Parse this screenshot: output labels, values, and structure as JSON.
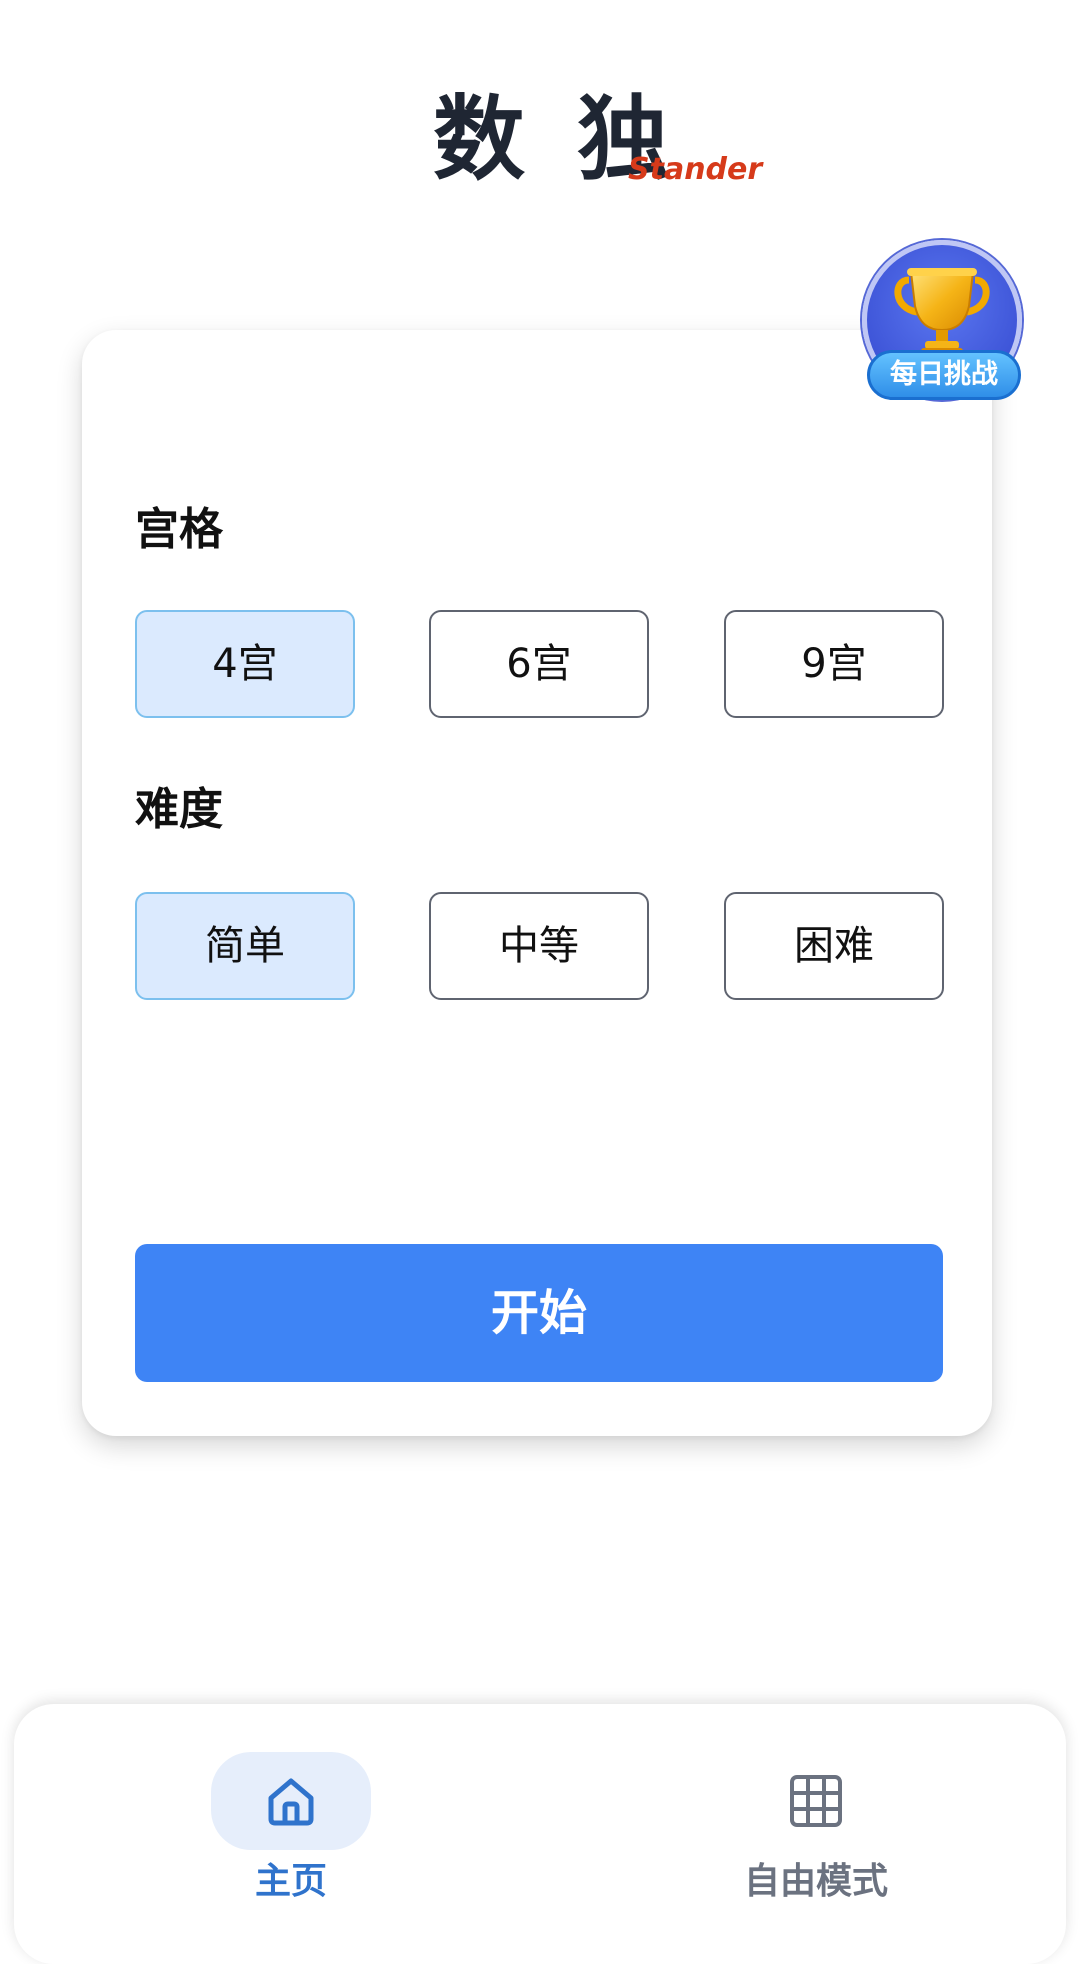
{
  "title": {
    "main": "数 独",
    "sub": "Stander"
  },
  "daily_challenge": {
    "label": "每日挑战",
    "icon": "trophy-icon"
  },
  "grid_section": {
    "label": "宫格",
    "options": [
      {
        "label": "4宫",
        "selected": true
      },
      {
        "label": "6宫",
        "selected": false
      },
      {
        "label": "9宫",
        "selected": false
      }
    ]
  },
  "difficulty_section": {
    "label": "难度",
    "options": [
      {
        "label": "简单",
        "selected": true
      },
      {
        "label": "中等",
        "selected": false
      },
      {
        "label": "困难",
        "selected": false
      }
    ]
  },
  "start_button": {
    "label": "开始"
  },
  "bottom_nav": {
    "items": [
      {
        "label": "主页",
        "icon": "home-icon",
        "active": true
      },
      {
        "label": "自由模式",
        "icon": "grid-icon",
        "active": false
      }
    ]
  },
  "colors": {
    "primary": "#3e84f5",
    "selected_bg": "#dbeafe",
    "selected_border": "#7cc0ee",
    "title": "#1f2633",
    "subtitle_accent": "#d63a1a",
    "nav_active": "#2f73cc",
    "nav_inactive": "#6b7280"
  }
}
